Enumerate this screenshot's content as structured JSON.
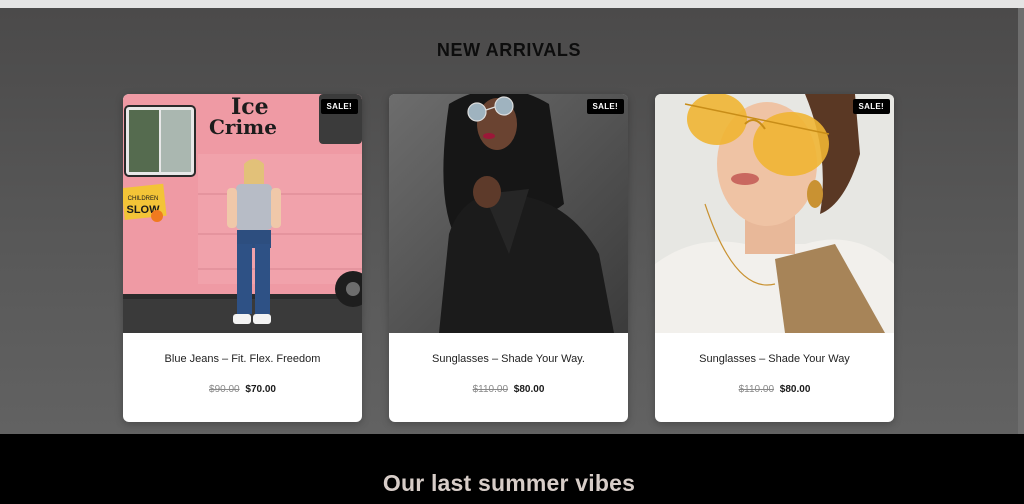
{
  "new_arrivals": {
    "heading": "NEW ARRIVALS",
    "products": [
      {
        "badge": "SALE!",
        "title": "Blue Jeans – Fit. Flex. Freedom",
        "old_price": "$90.00",
        "new_price": "$70.00",
        "image_icon": "woman-blue-jeans-pink-food-truck-photo",
        "truck_text_1": "Ice",
        "truck_text_2": "Crime",
        "sign_text_1": "SLOW",
        "sign_text_2": "CHILDREN"
      },
      {
        "badge": "SALE!",
        "title": "Sunglasses – Shade Your Way.",
        "old_price": "$110.00",
        "new_price": "$80.00",
        "image_icon": "woman-black-coat-sunglasses-photo"
      },
      {
        "badge": "SALE!",
        "title": "Sunglasses – Shade Your Way",
        "old_price": "$110.00",
        "new_price": "$80.00",
        "image_icon": "woman-yellow-aviator-sunglasses-photo"
      }
    ]
  },
  "summer": {
    "heading": "Our last summer vibes"
  },
  "colors": {
    "section_bg": "#555555",
    "badge_bg": "#000000",
    "footer_bg": "#000000",
    "footer_text": "#d7cdc8"
  }
}
